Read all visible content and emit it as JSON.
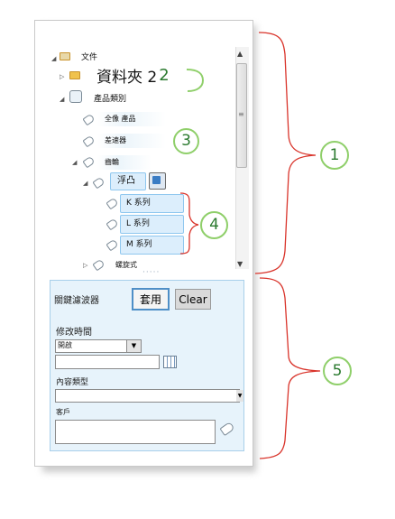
{
  "tree": {
    "root_label": "文件",
    "folder_label": "資料夾 2",
    "category_label": "產品類別",
    "item1_label": "全像 產品",
    "item2_label": "差速器",
    "item3_label": "齒輪",
    "item4_label": "浮凸",
    "sub1_label": "K 系列",
    "sub2_label": "L 系列",
    "sub3_label": "M 系列",
    "item5_label": "螺旋式"
  },
  "filter": {
    "title": "關鍵濾波器",
    "apply_label": "套用",
    "clear_label": "Clear",
    "modified_label": "修改時間",
    "modified_value": "開啟",
    "content_type_label": "內容類型",
    "customer_label": "客戶"
  },
  "callouts": {
    "c1": "1",
    "c2": "2",
    "c3": "3",
    "c4": "4",
    "c5": "5"
  },
  "colors": {
    "bracket": "#d9342b",
    "callout_ring": "#8fcf6a",
    "callout_text": "#2b7a2f",
    "filter_bg": "#e7f3fb"
  }
}
